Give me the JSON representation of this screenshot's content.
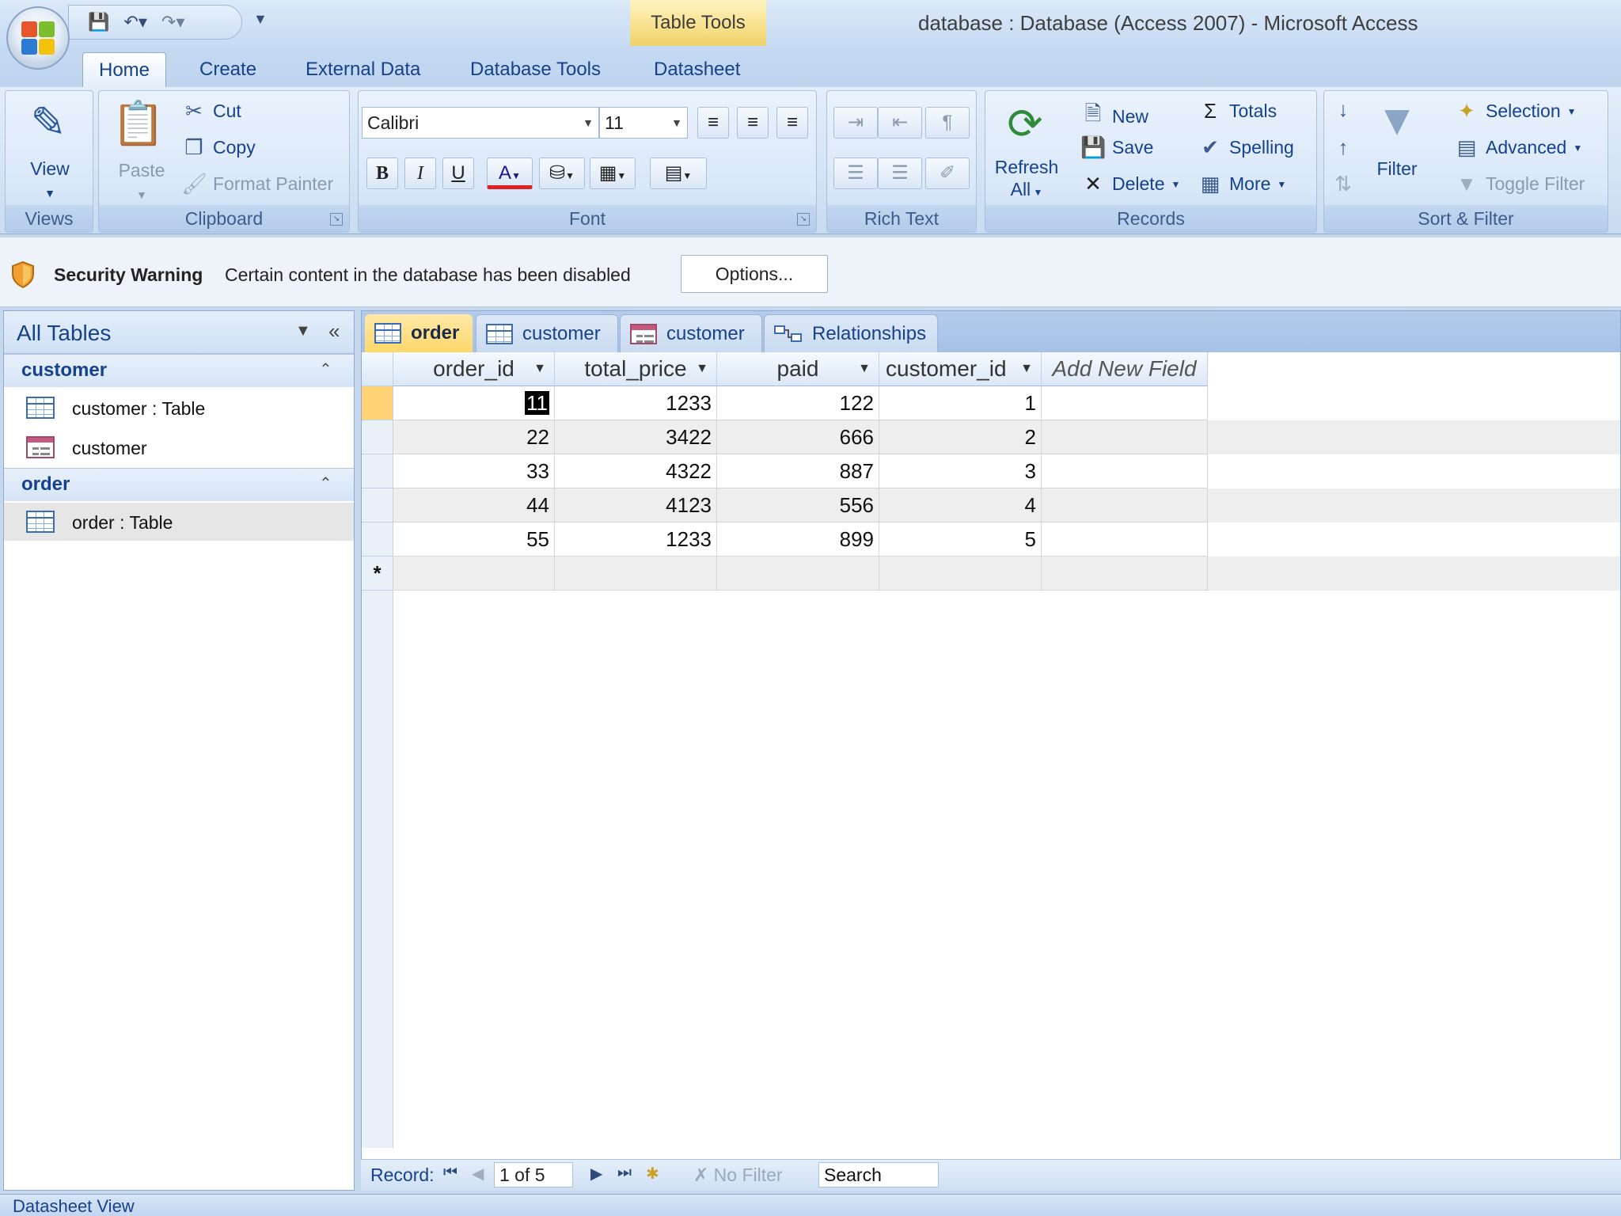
{
  "window": {
    "title": "database : Database (Access 2007) - Microsoft Access",
    "contextual_tab": "Table Tools"
  },
  "ribbon": {
    "tabs": [
      "Home",
      "Create",
      "External Data",
      "Database Tools",
      "Datasheet"
    ],
    "active_tab": "Home",
    "views": {
      "label": "Views",
      "view": "View"
    },
    "clipboard": {
      "label": "Clipboard",
      "paste": "Paste",
      "cut": "Cut",
      "copy": "Copy",
      "format_painter": "Format Painter"
    },
    "font": {
      "label": "Font",
      "family": "Calibri",
      "size": "11"
    },
    "rich_text": {
      "label": "Rich Text"
    },
    "records": {
      "label": "Records",
      "refresh": "Refresh",
      "refresh_all": "All",
      "new": "New",
      "save": "Save",
      "delete": "Delete",
      "totals": "Totals",
      "spelling": "Spelling",
      "more": "More"
    },
    "sort_filter": {
      "label": "Sort & Filter",
      "filter": "Filter",
      "selection": "Selection",
      "advanced": "Advanced",
      "toggle_filter": "Toggle Filter"
    }
  },
  "security_bar": {
    "title": "Security Warning",
    "message": "Certain content in the database has been disabled",
    "options_button": "Options..."
  },
  "nav_pane": {
    "title": "All Tables",
    "groups": [
      {
        "label": "customer",
        "items": [
          {
            "label": "customer : Table",
            "icon": "table-icon"
          },
          {
            "label": "customer",
            "icon": "form-icon"
          }
        ]
      },
      {
        "label": "order",
        "items": [
          {
            "label": "order : Table",
            "icon": "table-icon",
            "selected": true
          }
        ]
      }
    ]
  },
  "doc_tabs": [
    {
      "label": "order",
      "icon": "table-icon",
      "active": true
    },
    {
      "label": "customer",
      "icon": "table-icon",
      "active": false
    },
    {
      "label": "customer",
      "icon": "form-icon",
      "active": false
    },
    {
      "label": "Relationships",
      "icon": "relationships-icon",
      "active": false
    }
  ],
  "datasheet": {
    "columns": [
      "order_id",
      "total_price",
      "paid",
      "customer_id",
      "Add New Field"
    ],
    "rows": [
      [
        "11",
        "1233",
        "122",
        "1"
      ],
      [
        "22",
        "3422",
        "666",
        "2"
      ],
      [
        "33",
        "4322",
        "887",
        "3"
      ],
      [
        "44",
        "4123",
        "556",
        "4"
      ],
      [
        "55",
        "1233",
        "899",
        "5"
      ]
    ],
    "new_row_marker": "*"
  },
  "record_nav": {
    "label": "Record:",
    "position": "1 of 5",
    "filter_status": "No Filter",
    "search_placeholder": "Search"
  },
  "status_bar": {
    "text": "Datasheet View"
  },
  "colors": {
    "accent": "#15428b",
    "active_tab": "#ffd86a",
    "ribbon": "#d4e3f5"
  }
}
